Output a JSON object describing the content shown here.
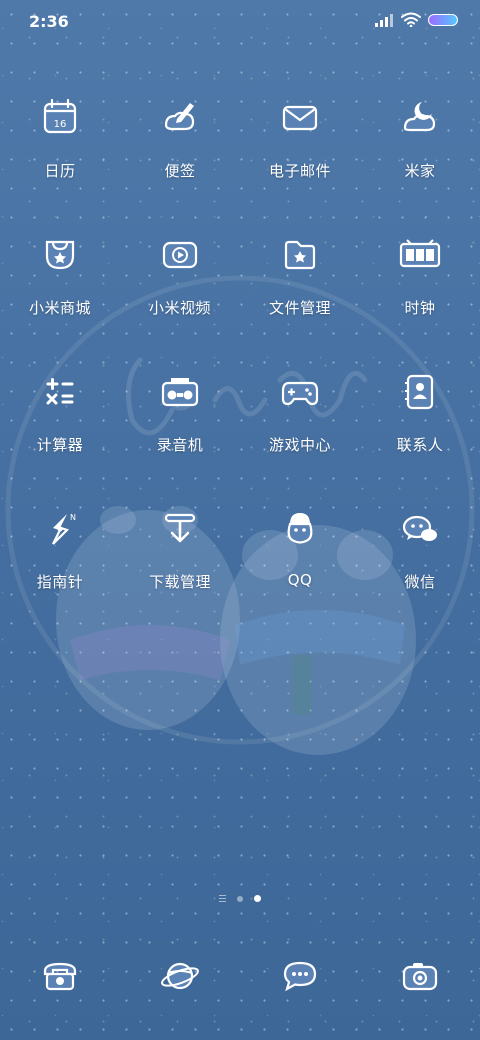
{
  "status_bar": {
    "time": "2:36"
  },
  "apps": [
    {
      "label": "日历",
      "icon": "calendar-icon",
      "text": "16"
    },
    {
      "label": "便签",
      "icon": "notes-icon"
    },
    {
      "label": "电子邮件",
      "icon": "email-icon"
    },
    {
      "label": "米家",
      "icon": "mijia-icon"
    },
    {
      "label": "小米商城",
      "icon": "mi-store-icon"
    },
    {
      "label": "小米视频",
      "icon": "mi-video-icon"
    },
    {
      "label": "文件管理",
      "icon": "file-manager-icon"
    },
    {
      "label": "时钟",
      "icon": "clock-icon"
    },
    {
      "label": "计算器",
      "icon": "calculator-icon"
    },
    {
      "label": "录音机",
      "icon": "recorder-icon"
    },
    {
      "label": "游戏中心",
      "icon": "game-center-icon"
    },
    {
      "label": "联系人",
      "icon": "contacts-icon"
    },
    {
      "label": "指南针",
      "icon": "compass-icon"
    },
    {
      "label": "下载管理",
      "icon": "download-manager-icon"
    },
    {
      "label": "QQ",
      "icon": "qq-icon"
    },
    {
      "label": "微信",
      "icon": "wechat-icon"
    }
  ],
  "page_indicator": {
    "current": 2,
    "total": 2
  },
  "dock": [
    {
      "icon": "phone-icon"
    },
    {
      "icon": "browser-icon"
    },
    {
      "icon": "messages-icon"
    },
    {
      "icon": "camera-icon"
    }
  ],
  "colors": {
    "background": "#4872a3",
    "icon_stroke": "#ffffff",
    "icon_fill": "#5b82b4"
  }
}
